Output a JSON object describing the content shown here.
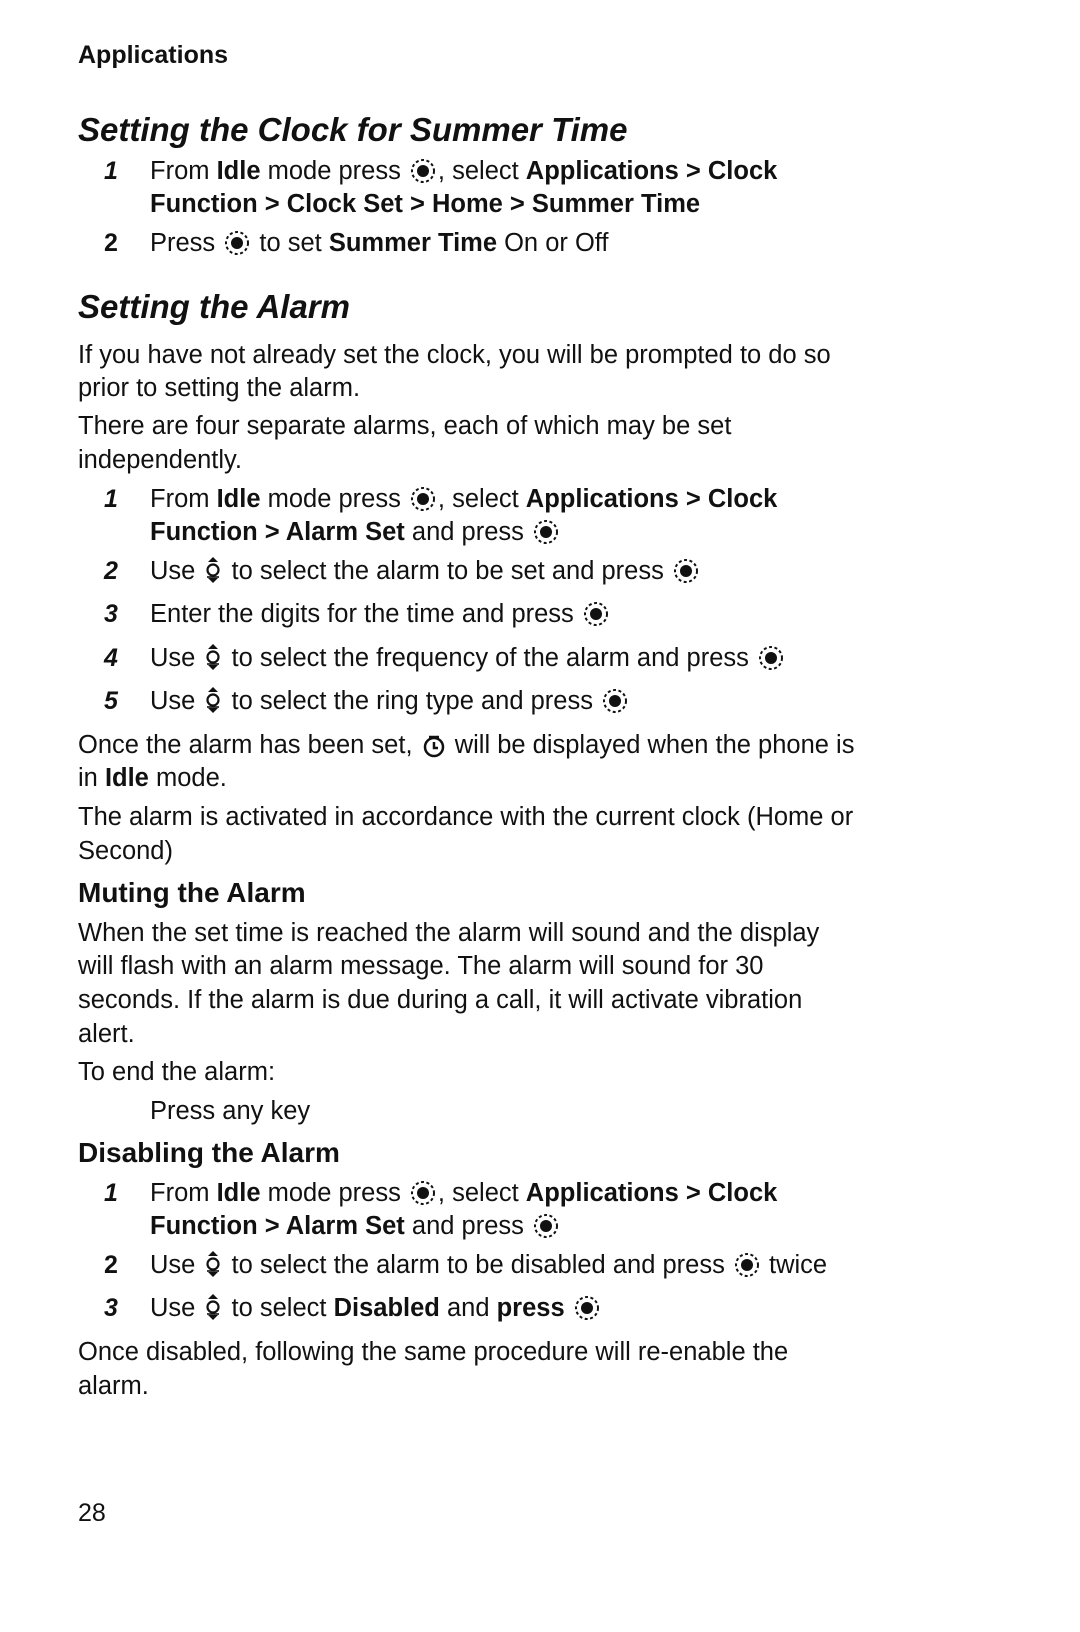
{
  "header": {
    "running_title": "Applications"
  },
  "sections": {
    "summer_time": {
      "title": "Setting the Clock for Summer Time",
      "steps": [
        {
          "num": "1",
          "parts": [
            "From ",
            "Idle",
            " mode press ",
            ", select ",
            "Applications > Clock",
            "Function > Clock Set > Home > Summer Time"
          ]
        },
        {
          "num": "2",
          "parts": [
            "Press ",
            " to set ",
            "Summer Time",
            " On or Off"
          ]
        }
      ]
    },
    "alarm": {
      "title": "Setting the Alarm",
      "intro1": [
        "If you have not already set the clock, you will be prompted to do so",
        "prior to setting the alarm."
      ],
      "intro2": [
        "There are four separate alarms, each of which may be set",
        "independently."
      ],
      "steps": [
        {
          "num": "1",
          "parts": [
            "From ",
            "Idle",
            " mode press ",
            ", select ",
            "Applications > Clock",
            "Function > Alarm Set",
            " and press "
          ]
        },
        {
          "num": "2",
          "parts": [
            "Use ",
            " to select the alarm to be set and press "
          ]
        },
        {
          "num": "3",
          "parts": [
            "Enter the digits for the time and press "
          ]
        },
        {
          "num": "4",
          "parts": [
            "Use ",
            " to select the frequency of the alarm and press "
          ]
        },
        {
          "num": "5",
          "parts": [
            "Use ",
            " to select the ring type and press "
          ]
        }
      ],
      "after1": [
        "Once the alarm has been set, ",
        " will be displayed when the phone is",
        "in ",
        "Idle",
        " mode."
      ],
      "after2": [
        "The alarm is activated in accordance with the current clock (Home or",
        "Second)"
      ]
    },
    "muting": {
      "title": "Muting the Alarm",
      "body": [
        "When the set time is reached the alarm will sound and the display",
        "will flash with an alarm message. The alarm will sound for 30",
        "seconds. If the alarm is due during a call, it will activate vibration",
        "alert."
      ],
      "end_label": "To end the alarm:",
      "end_action": "Press any key"
    },
    "disabling": {
      "title": "Disabling the Alarm",
      "steps": [
        {
          "num": "1",
          "parts": [
            "From ",
            "Idle",
            " mode press ",
            ", select ",
            "Applications > Clock",
            "Function > Alarm Set",
            " and press "
          ]
        },
        {
          "num": "2",
          "parts": [
            "Use ",
            " to select the alarm to be disabled and press ",
            " twice"
          ]
        },
        {
          "num": "3",
          "parts": [
            "Use ",
            " to select ",
            "Disabled",
            " and ",
            "press",
            " "
          ]
        }
      ],
      "outro": [
        "Once disabled, following the same procedure will re-enable the",
        "alarm."
      ]
    }
  },
  "icons": {
    "select": "select-key-icon",
    "navigate": "navigation-key-icon",
    "alarm": "alarm-clock-icon"
  },
  "footer": {
    "page_number": "28"
  }
}
